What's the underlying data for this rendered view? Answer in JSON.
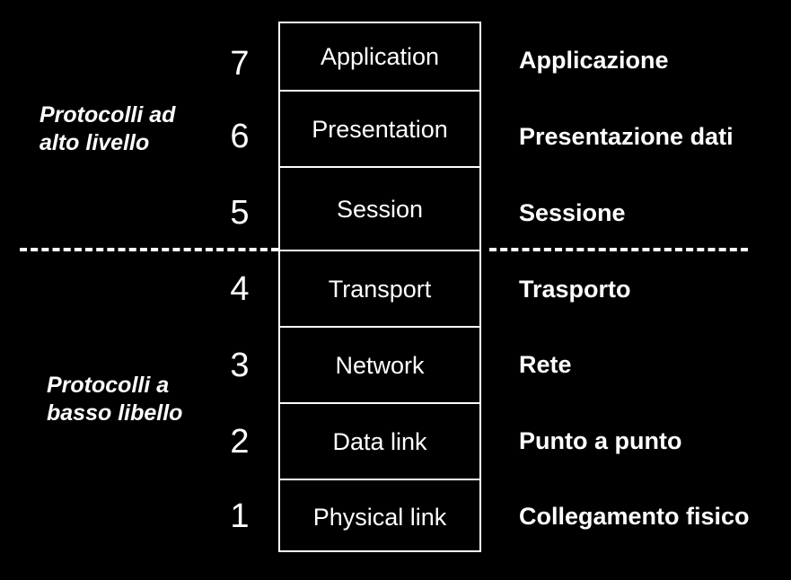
{
  "figure": {
    "background_color": "#000000",
    "foreground_color": "#ffffff"
  },
  "groups": [
    {
      "id": "high",
      "label": "Protocolli ad\nalto livello",
      "covers_layers": [
        7,
        6,
        5
      ]
    },
    {
      "id": "low",
      "label": "Protocolli a\nbasso libello",
      "covers_layers": [
        3,
        2
      ]
    }
  ],
  "divider": {
    "style": "dashed",
    "between_layers": [
      5,
      4
    ]
  },
  "layers": [
    {
      "number": "7",
      "name": "Application",
      "italian": "Applicazione"
    },
    {
      "number": "6",
      "name": "Presentation",
      "italian": "Presentazione dati"
    },
    {
      "number": "5",
      "name": "Session",
      "italian": "Sessione"
    },
    {
      "number": "4",
      "name": "Transport",
      "italian": "Trasporto"
    },
    {
      "number": "3",
      "name": "Network",
      "italian": "Rete"
    },
    {
      "number": "2",
      "name": "Data link",
      "italian": "Punto a punto"
    },
    {
      "number": "1",
      "name": "Physical link",
      "italian": "Collegamento fisico"
    }
  ],
  "layout": {
    "row_tops": [
      24,
      100,
      185,
      278,
      363,
      448,
      533
    ],
    "row_bottoms": [
      100,
      185,
      278,
      363,
      448,
      533,
      615
    ],
    "number_baselines": [
      52,
      133,
      218,
      303,
      388,
      473,
      556
    ],
    "italian_tops": [
      52,
      137,
      222,
      307,
      391,
      476,
      560
    ]
  }
}
